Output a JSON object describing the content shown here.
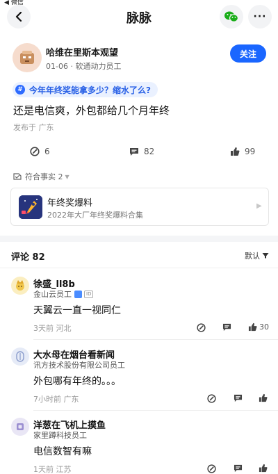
{
  "status_bar": {
    "back_label": "◀ 微信"
  },
  "header": {
    "title": "脉脉"
  },
  "post": {
    "author": {
      "name": "哈维在里斯本观望",
      "meta": "01-06 · 软通动力员工"
    },
    "follow_label": "关注",
    "topic_tag": "今年年终奖能拿多少？缩水了么?",
    "text": "还是电信爽，外包都给几个月年终",
    "location": "发布于 广东",
    "actions": {
      "comment_count": "6",
      "reply_count": "82",
      "like_count": "99"
    },
    "facts_label": "符合事实 2",
    "card": {
      "title": "年终奖爆料",
      "subtitle": "2022年大厂年终奖爆料合集"
    }
  },
  "comments": {
    "title": "评论 82",
    "sort_label": "默认",
    "items": [
      {
        "name": "徐盛_ll8b",
        "role": "金山云员工",
        "text": "天翼云一直一视同仁",
        "meta": "3天前  河北",
        "like_count": "30"
      },
      {
        "name": "大水母在烟台看新闻",
        "role": "讯方技术股份有限公司员工",
        "text": "外包哪有年终的。。。",
        "meta": "7小时前  广东",
        "like_count": ""
      },
      {
        "name": "洋葱在飞机上摸鱼",
        "role": "家里蹲科技员工",
        "text": "电信数智有嘛",
        "meta": "1天前  江苏",
        "like_count": ""
      }
    ]
  },
  "colors": {
    "accent": "#1a66ff",
    "tag_bg": "#eaf1ff",
    "wechat_green": "#1aad19"
  }
}
